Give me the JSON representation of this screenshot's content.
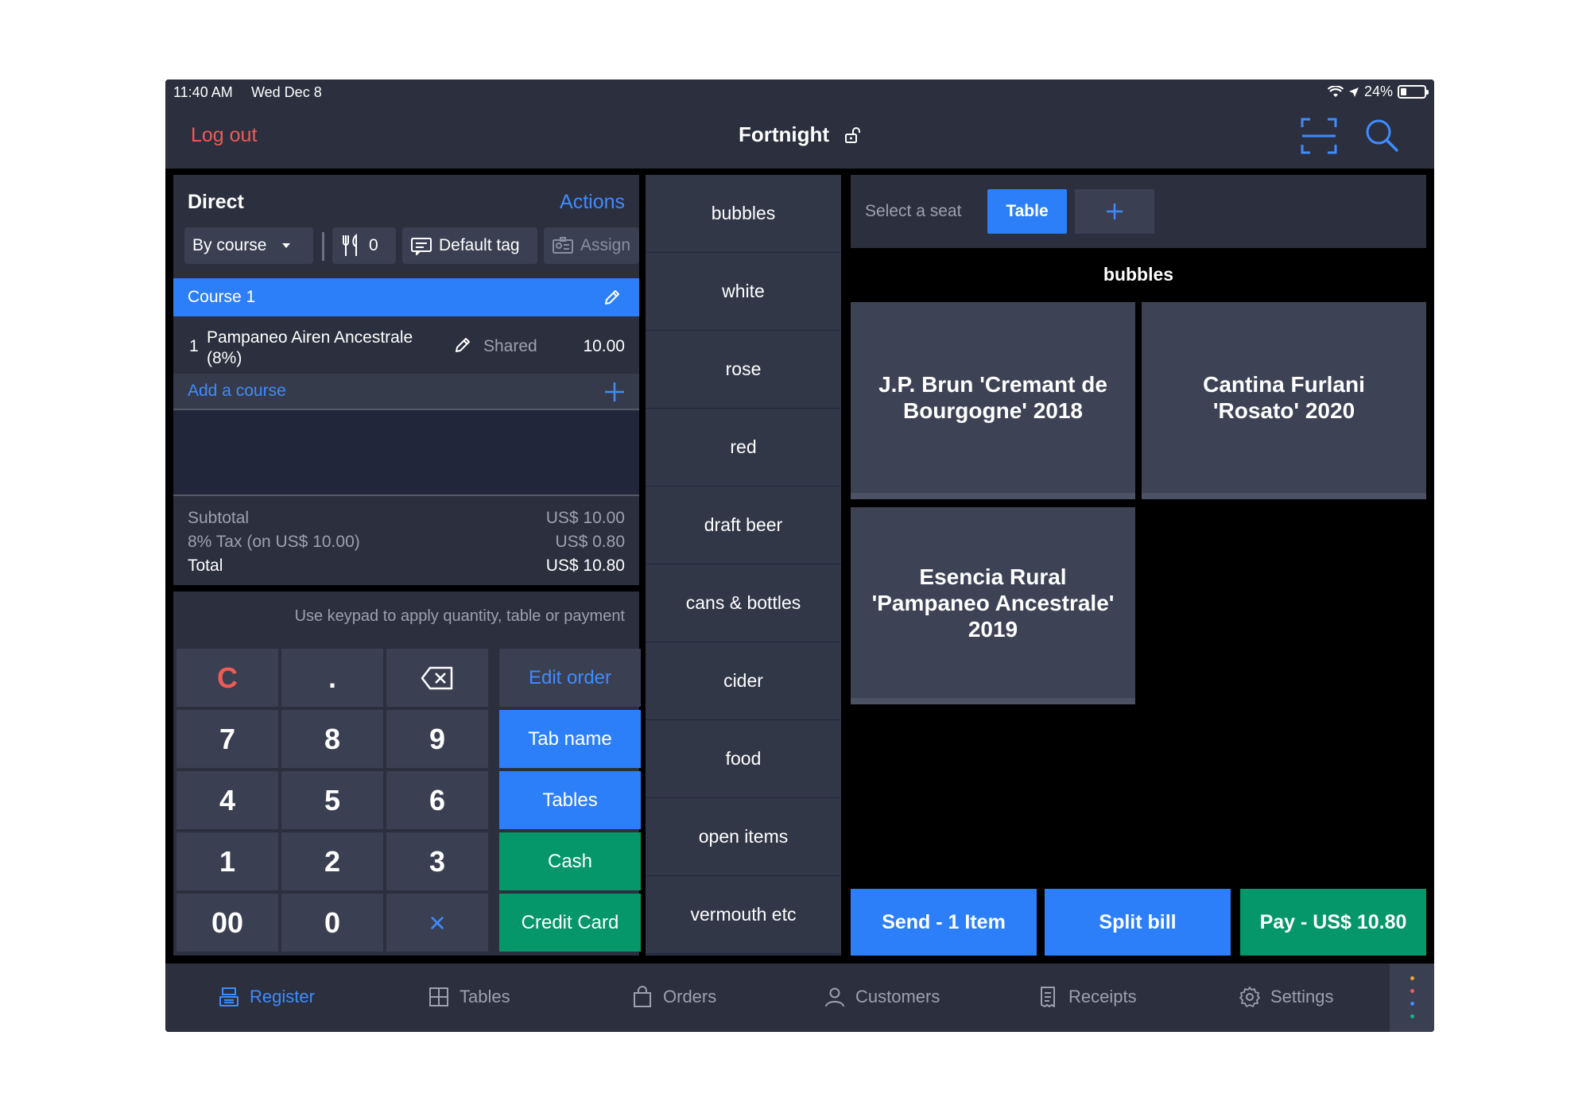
{
  "status_bar": {
    "time": "11:40 AM",
    "date": "Wed Dec 8",
    "battery": "24%"
  },
  "header": {
    "logout_label": "Log out",
    "venue_name": "Fortnight"
  },
  "ticket": {
    "title": "Direct",
    "actions_label": "Actions",
    "by_course_label": "By course",
    "guest_count": "0",
    "default_tag_label": "Default tag",
    "assign_label": "Assign",
    "course_label": "Course 1",
    "items": [
      {
        "qty": "1",
        "name": "Pampaneo Airen Ancestrale (8%)",
        "shared": "Shared",
        "price": "10.00"
      }
    ],
    "add_course_label": "Add a course",
    "subtotal_label": "Subtotal",
    "subtotal_value": "US$ 10.00",
    "tax_label": "8% Tax (on US$ 10.00)",
    "tax_value": "US$ 0.80",
    "total_label": "Total",
    "total_value": "US$ 10.80"
  },
  "keypad": {
    "hint": "Use keypad to apply quantity, table or payment",
    "keys": [
      "C",
      ".",
      "7",
      "8",
      "9",
      "4",
      "5",
      "6",
      "1",
      "2",
      "3",
      "00",
      "0",
      "×"
    ],
    "edit_order": "Edit order",
    "tab_name": "Tab name",
    "tables": "Tables",
    "cash": "Cash",
    "credit_card": "Credit Card"
  },
  "categories": [
    "bubbles",
    "white",
    "rose",
    "red",
    "draft beer",
    "cans & bottles",
    "cider",
    "food",
    "open items",
    "vermouth etc"
  ],
  "seat_bar": {
    "label": "Select a seat",
    "table_label": "Table"
  },
  "section_title": "bubbles",
  "products": [
    "J.P. Brun 'Cremant de Bourgogne' 2018",
    "Cantina Furlani 'Rosato' 2020",
    "Esencia Rural 'Pampaneo Ancestrale' 2019"
  ],
  "bottom_actions": {
    "send": "Send - 1 Item",
    "split": "Split bill",
    "pay": "Pay - US$ 10.80"
  },
  "tabs": [
    "Register",
    "Tables",
    "Orders",
    "Customers",
    "Receipts",
    "Settings"
  ],
  "colors": {
    "accent": "#2d7ff9",
    "success": "#059669",
    "danger": "#ef5b55",
    "panel": "#2b2f3e"
  }
}
